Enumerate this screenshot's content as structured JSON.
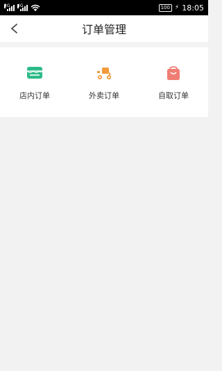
{
  "status_bar": {
    "net1": "3G",
    "net2": "4G",
    "battery": "100",
    "charging": "⚡",
    "time": "18:05"
  },
  "header": {
    "title": "订单管理",
    "back_icon": "back-arrow-icon"
  },
  "categories": [
    {
      "label": "店内订单",
      "icon": "store-icon",
      "color": "#2dbb88"
    },
    {
      "label": "外卖订单",
      "icon": "delivery-scooter-icon",
      "color": "#f39a3d"
    },
    {
      "label": "自取订单",
      "icon": "shopping-bag-icon",
      "color": "#f07d74"
    }
  ],
  "colors": {
    "background": "#f2f2f2",
    "text": "#333333",
    "store_icon": "#2dbb88",
    "delivery_icon": "#f39a3d",
    "pickup_icon": "#f07d74"
  }
}
